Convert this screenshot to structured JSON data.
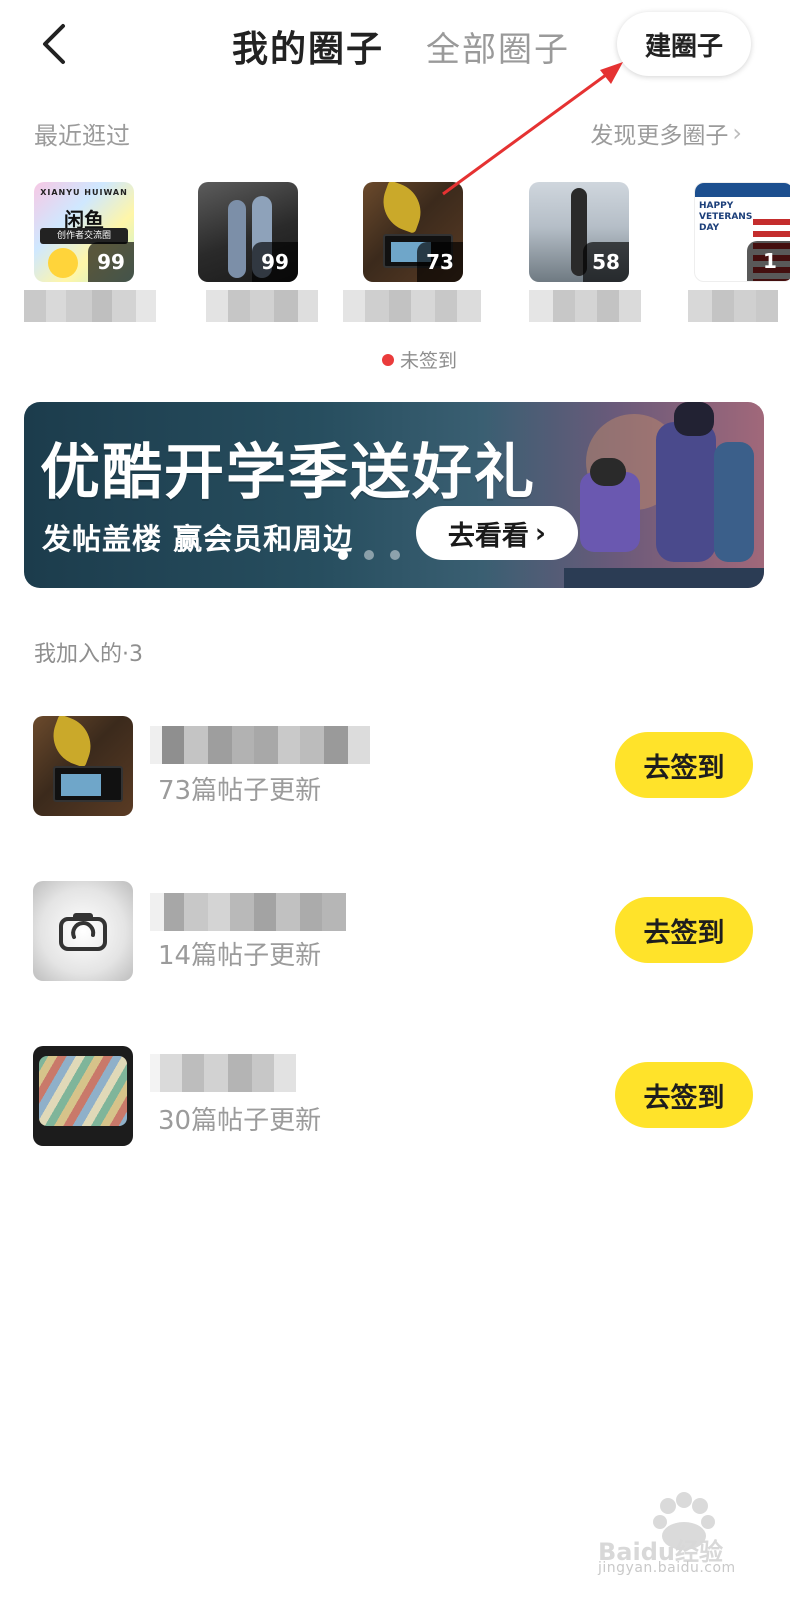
{
  "header": {
    "tab_mine": "我的圈子",
    "tab_all": "全部圈子",
    "create_label": "建圈子"
  },
  "recent": {
    "label": "最近逛过",
    "discover_more": "发现更多圈子",
    "items": [
      {
        "count": "99",
        "thumb_logo_top": "XIANYU HUIWAN",
        "thumb_logo_main": "闲鱼",
        "thumb_logo_sub": "创作者交流圈"
      },
      {
        "count": "99"
      },
      {
        "count": "73"
      },
      {
        "count": "58"
      },
      {
        "count": "1",
        "thumb_text": "HAPPY VETERANS DAY"
      }
    ],
    "unsigned_status": "未签到"
  },
  "banner": {
    "headline": "优酷开学季送好礼",
    "subline": "发帖盖楼  赢会员和周边",
    "cta": "去看看",
    "active_slide": 1,
    "slide_count": 3
  },
  "joined": {
    "label": "我加入的·3",
    "items": [
      {
        "subtitle": "73篇帖子更新",
        "button": "去签到"
      },
      {
        "subtitle": "14篇帖子更新",
        "button": "去签到"
      },
      {
        "subtitle": "30篇帖子更新",
        "button": "去签到"
      }
    ]
  },
  "watermark": {
    "text": "jingyan.baidu.com",
    "logo": "Baidu经验"
  },
  "colors": {
    "accent_yellow": "#ffe32a",
    "status_red": "#ea3b3b",
    "annotation_red": "#e53232"
  },
  "icons": [
    "chevron-left-icon",
    "chevron-right-icon",
    "camera-icon"
  ]
}
